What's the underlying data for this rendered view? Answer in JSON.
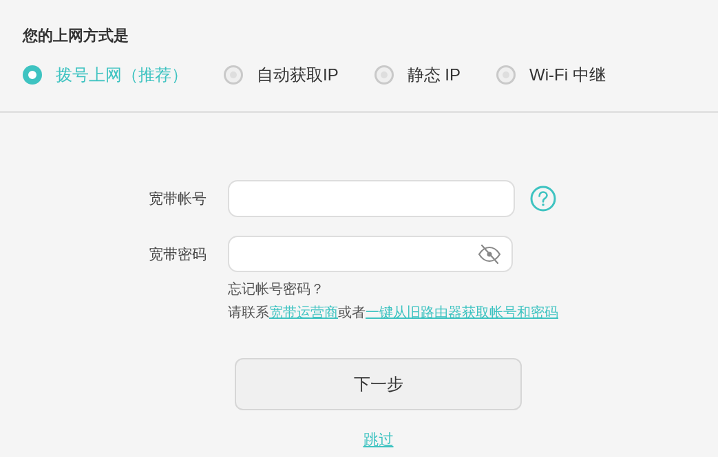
{
  "section_title": "您的上网方式是",
  "connection_types": [
    {
      "label": "拨号上网（推荐）",
      "selected": true
    },
    {
      "label": "自动获取IP",
      "selected": false
    },
    {
      "label": "静态 IP",
      "selected": false
    },
    {
      "label": "Wi-Fi 中继",
      "selected": false
    }
  ],
  "fields": [
    {
      "kind": "account",
      "label": "宽带帐号"
    },
    {
      "kind": "password",
      "label": "宽带密码"
    }
  ],
  "forgot": {
    "question": "忘记帐号密码？",
    "contact": [
      {
        "kind": "text",
        "text": "请联系"
      },
      {
        "kind": "link",
        "text": "宽带运营商"
      },
      {
        "kind": "text",
        "text": "或者"
      },
      {
        "kind": "link",
        "text": "一键从旧路由器获取帐号和密码"
      }
    ]
  },
  "next_button": "下一步",
  "skip_link": "跳过"
}
